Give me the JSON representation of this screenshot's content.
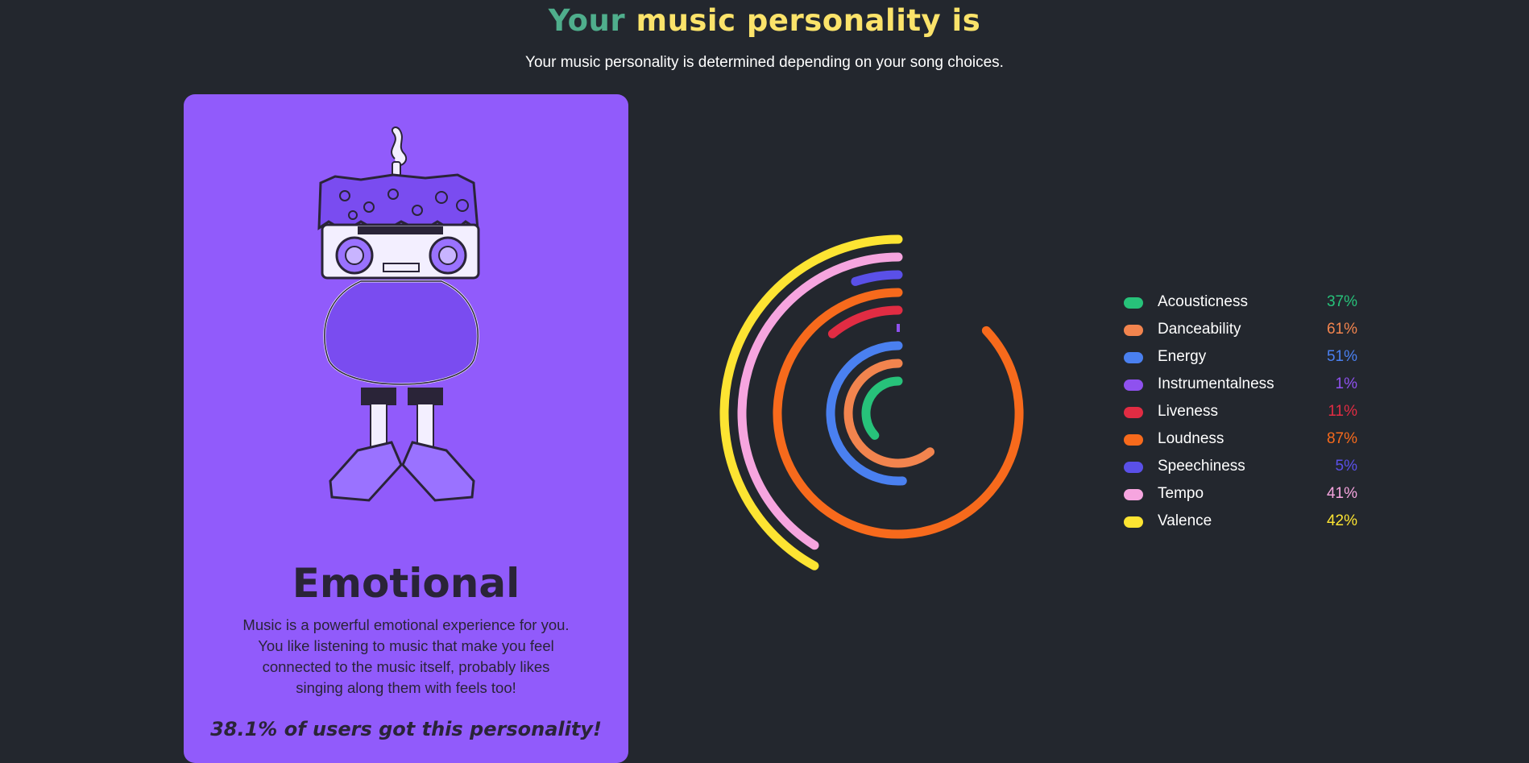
{
  "header": {
    "title_part1": "Your",
    "title_part2": "music personality is",
    "subtitle": "Your music personality is determined depending on your song choices."
  },
  "personality": {
    "name": "Emotional",
    "description": "Music is a powerful emotional experience for you. You like listening to music that make you feel connected to the music itself, probably likes singing along them with feels too!",
    "stat": "38.1% of users got this personality!",
    "card_color": "#915bfb"
  },
  "chart_data": {
    "type": "radial-bar",
    "unit": "%",
    "series": [
      {
        "label": "Acousticness",
        "value": 37,
        "display": "37%",
        "color": "#27c27a"
      },
      {
        "label": "Danceability",
        "value": 61,
        "display": "61%",
        "color": "#f2844e"
      },
      {
        "label": "Energy",
        "value": 51,
        "display": "51%",
        "color": "#4a80f0"
      },
      {
        "label": "Instrumentalness",
        "value": 1,
        "display": "1%",
        "color": "#8f51ef"
      },
      {
        "label": "Liveness",
        "value": 11,
        "display": "11%",
        "color": "#e12c43"
      },
      {
        "label": "Loudness",
        "value": 87,
        "display": "87%",
        "color": "#f76a1c"
      },
      {
        "label": "Speechiness",
        "value": 5,
        "display": "5%",
        "color": "#5a50e8"
      },
      {
        "label": "Tempo",
        "value": 41,
        "display": "41%",
        "color": "#f6a5df"
      },
      {
        "label": "Valence",
        "value": 42,
        "display": "42%",
        "color": "#fde432"
      }
    ]
  }
}
